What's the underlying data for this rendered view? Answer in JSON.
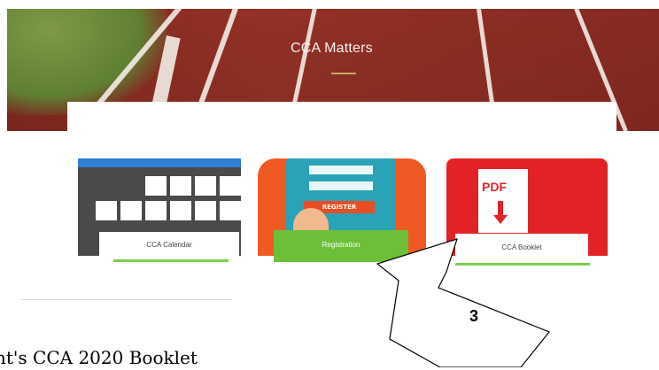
{
  "hero": {
    "title": "CCA Matters"
  },
  "tiles": {
    "calendar": {
      "label": "CCA Calendar",
      "icon": "calendar-icon"
    },
    "registration": {
      "label": "Registration",
      "button_text": "REGISTER",
      "icon": "register-icon"
    },
    "booklet": {
      "label": "CCA Booklet",
      "icon_text": "PDF",
      "icon": "pdf-icon"
    }
  },
  "annotation": {
    "step": "3"
  },
  "footer": {
    "text": "nt's CCA 2020 Booklet"
  },
  "colors": {
    "accent_green": "#6dbf3a",
    "pdf_red": "#e32228",
    "register_orange": "#ef5a24",
    "calendar_blue": "#2f7fd6"
  }
}
